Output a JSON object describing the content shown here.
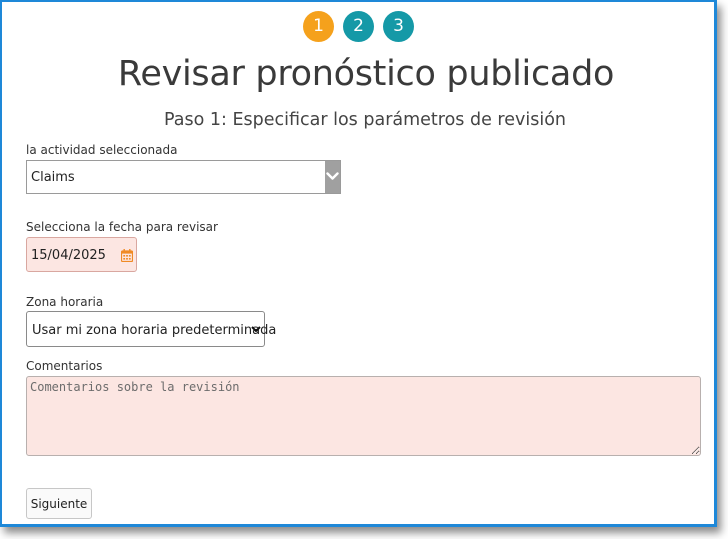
{
  "wizard": {
    "steps": [
      "1",
      "2",
      "3"
    ],
    "active_step": 1,
    "step_colors": {
      "active": "#f5a11c",
      "inactive": "#1599a7"
    }
  },
  "page": {
    "title": "Revisar pronóstico publicado",
    "subtitle": "Paso 1: Especificar los parámetros de revisión"
  },
  "form": {
    "activity": {
      "label": "la actividad seleccionada",
      "value": "Claims"
    },
    "date": {
      "label": "Selecciona la fecha para revisar",
      "value": "15/04/2025"
    },
    "timezone": {
      "label": "Zona horaria",
      "value": "Usar mi zona horaria predeterminada"
    },
    "comments": {
      "label": "Comentarios",
      "placeholder": "Comentarios sobre la revisión",
      "value": ""
    },
    "next_label": "Siguiente"
  },
  "icons": {
    "activity_dropdown": "chevron-down-icon",
    "date_picker": "calendar-icon",
    "timezone_dropdown": "chevron-down-icon"
  }
}
